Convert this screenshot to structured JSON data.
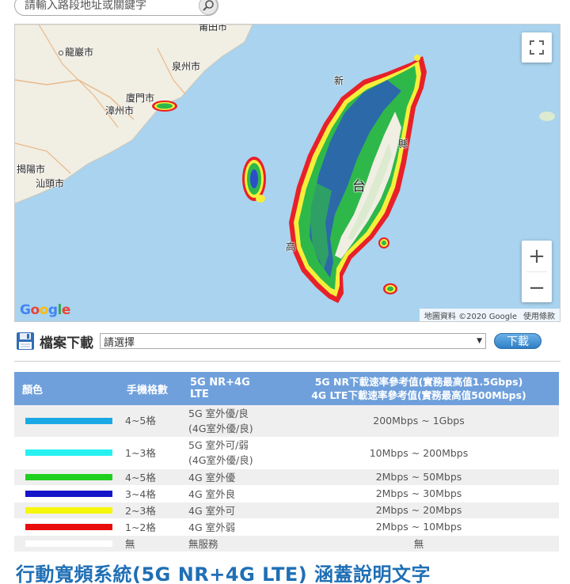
{
  "search": {
    "placeholder": "請輸入路段地址或關鍵字"
  },
  "map": {
    "cities": [
      {
        "name": "龍巖市"
      },
      {
        "name": "泉州市"
      },
      {
        "name": "廈門市"
      },
      {
        "name": "漳州市"
      },
      {
        "name": "揭陽市"
      },
      {
        "name": "汕頭市"
      },
      {
        "name": "新"
      },
      {
        "name": "縣"
      },
      {
        "name": "台"
      },
      {
        "name": "高"
      },
      {
        "name": "莆田市"
      }
    ],
    "logo": "Google",
    "attribution": "地圖資料 ©2020 Google",
    "terms": "使用條款",
    "zoom_in": "+",
    "zoom_out": "−",
    "colors": {
      "sea": "#a9d3ee",
      "land": "#f1eee3",
      "coverage_green": "#2fb84a",
      "coverage_blue": "#2c4fc9",
      "coverage_yellow": "#f6ef3a",
      "coverage_red": "#e8202a"
    }
  },
  "download": {
    "label": "檔案下載",
    "select_value": "請選擇",
    "button": "下載"
  },
  "legend": {
    "headers": {
      "color": "顏色",
      "signal": "手機格數",
      "service": "5G NR+4G LTE",
      "speed_line1": "5G NR下載速率參考值(實務最高值1.5Gbps)",
      "speed_line2": "4G LTE下載速率參考值(實務最高值500Mbps)"
    },
    "rows": [
      {
        "color": "#1aa9e6",
        "signal": "4~5格",
        "service1": "5G 室外優/良",
        "service2": "(4G室外優/良)",
        "speed": "200Mbps ~ 1Gbps"
      },
      {
        "color": "#27f1f1",
        "signal": "1~3格",
        "service1": "5G 室外可/弱",
        "service2": "(4G室外優/良)",
        "speed": "10Mbps ~ 200Mbps"
      },
      {
        "color": "#1fd01f",
        "signal": "4~5格",
        "service1": "4G 室外優",
        "speed": "2Mbps ~ 50Mbps"
      },
      {
        "color": "#1414c8",
        "signal": "3~4格",
        "service1": "4G 室外良",
        "speed": "2Mbps ~ 30Mbps"
      },
      {
        "color": "#f7f70a",
        "signal": "2~3格",
        "service1": "4G 室外可",
        "speed": "2Mbps ~ 20Mbps"
      },
      {
        "color": "#e80c0c",
        "signal": "1~2格",
        "service1": "4G 室外弱",
        "speed": "2Mbps ~ 10Mbps"
      },
      {
        "color": "#ffffff",
        "signal": "無",
        "service1": "無服務",
        "speed": "無"
      }
    ]
  },
  "heading": "行動寬頻系統(5G NR+4G LTE) 涵蓋說明文字"
}
